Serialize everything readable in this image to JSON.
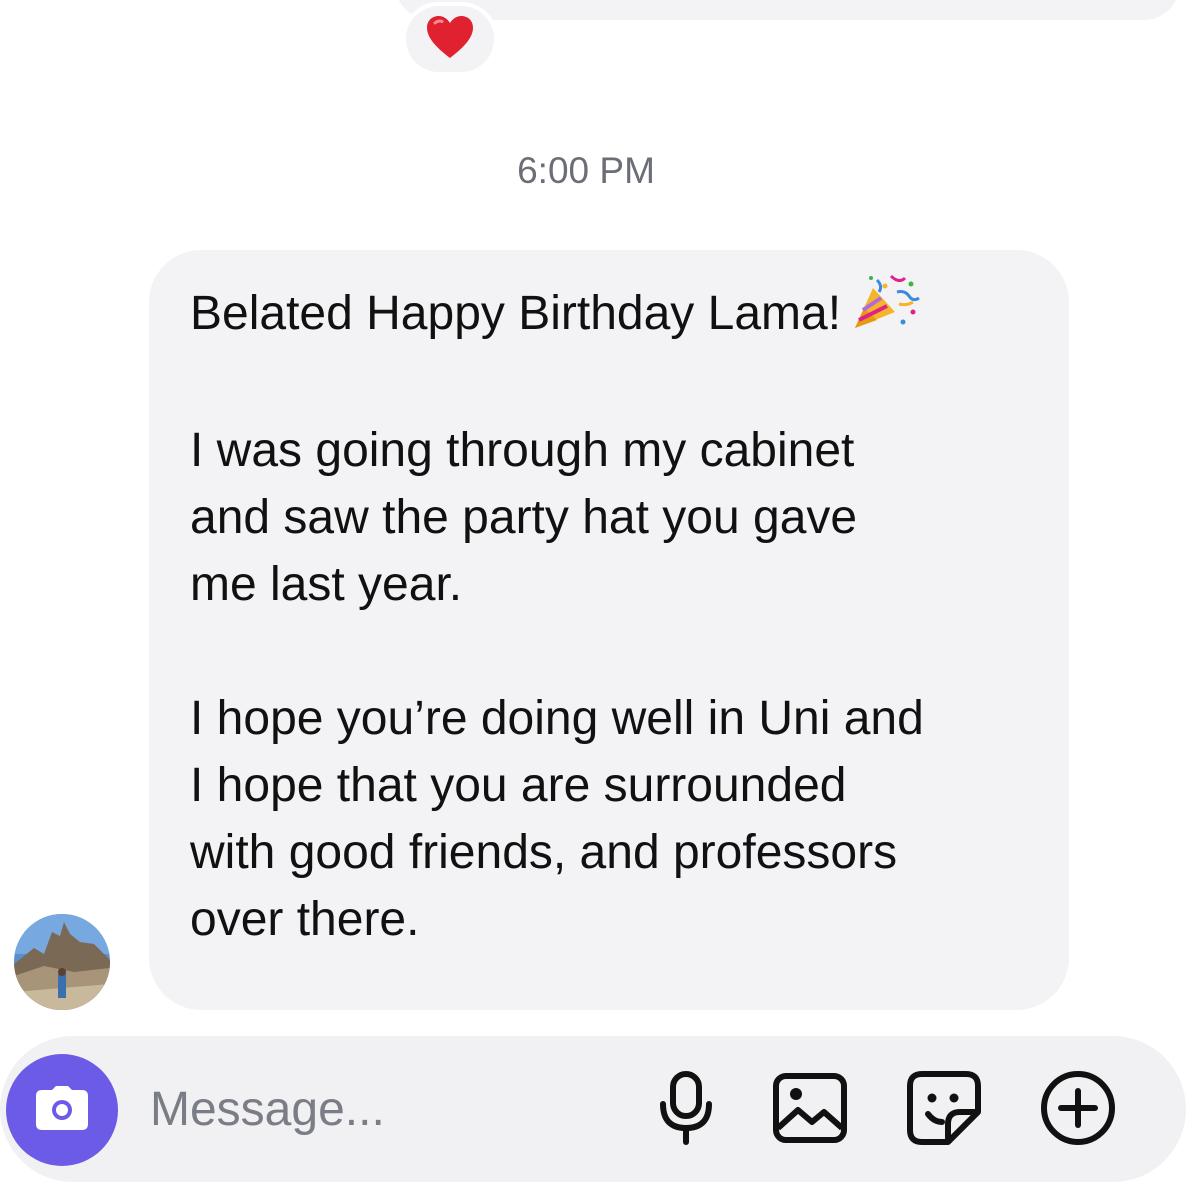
{
  "previous_message": {
    "reaction": "heart-icon"
  },
  "thread": {
    "timestamp": "6:00 PM"
  },
  "message": {
    "paragraphs": [
      "Belated Happy Birthday Lama!",
      "I was going through my cabinet\nand saw the party hat you gave\nme last year.",
      "I hope you’re doing well in Uni and\nI hope that you are surrounded\nwith good friends, and professors\nover there."
    ],
    "emoji": "party-popper-icon"
  },
  "composer": {
    "placeholder": "Message...",
    "value": "",
    "camera_icon": "camera-icon",
    "tools": [
      "microphone-icon",
      "gallery-icon",
      "sticker-icon",
      "plus-circle-icon"
    ],
    "accent_color": "#6b5be6"
  },
  "colors": {
    "bubble": "#f3f3f5",
    "timestamp": "#6b6e76",
    "heart": "#e0212f"
  }
}
